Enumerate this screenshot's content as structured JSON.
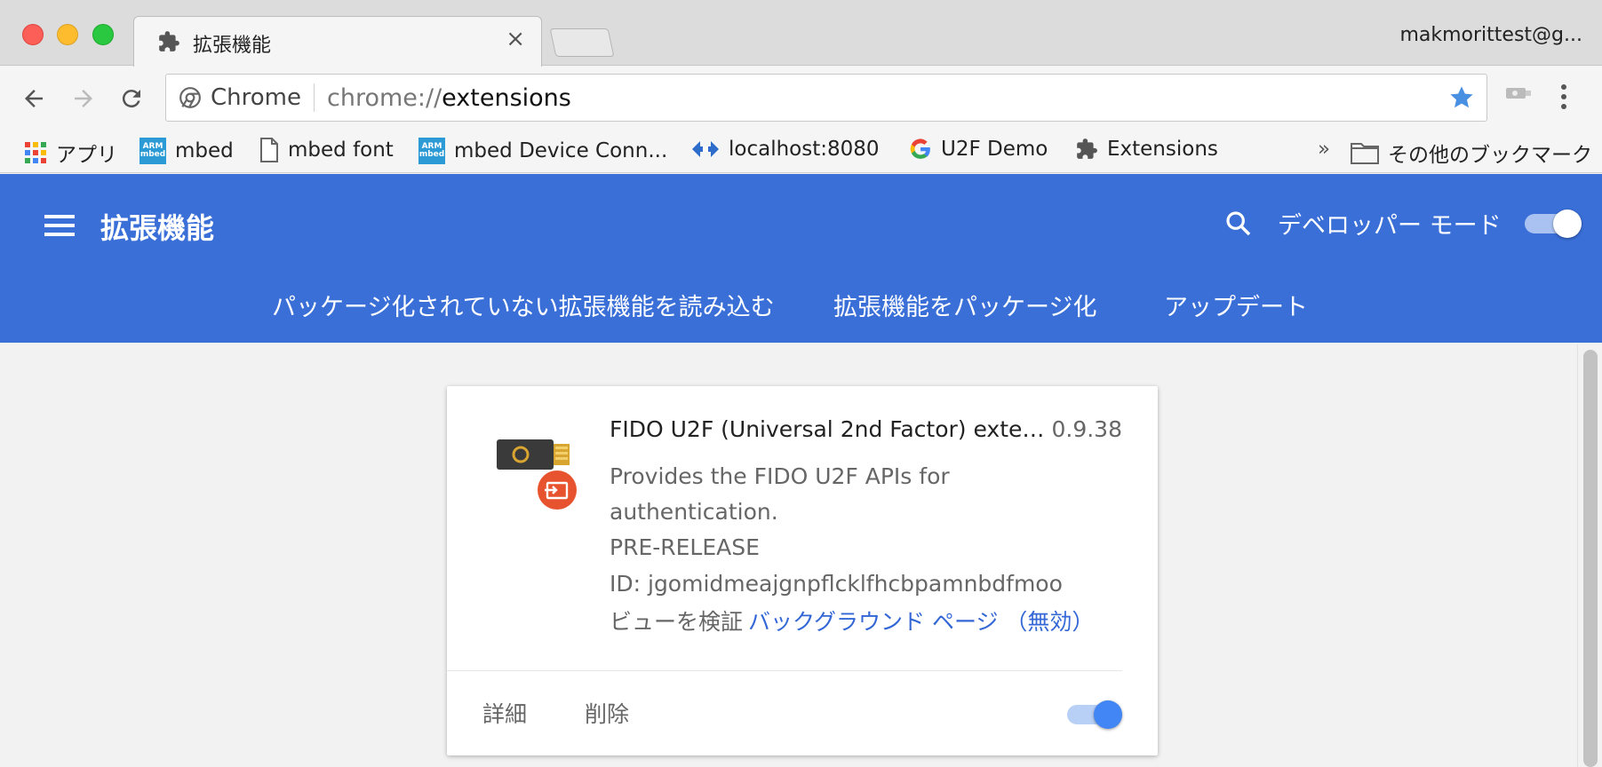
{
  "window": {
    "tab_title": "拡張機能",
    "tab_close": "×",
    "profile": "makmorittest@g..."
  },
  "toolbar": {
    "omnibox_chip": "Chrome",
    "url_prefix": "chrome://",
    "url_path": "extensions"
  },
  "bookmarks": [
    {
      "label": "アプリ",
      "icon": "apps-grid-icon"
    },
    {
      "label": "mbed",
      "icon": "arm-mbed-icon"
    },
    {
      "label": "mbed font",
      "icon": "page-icon"
    },
    {
      "label": "mbed Device Conn...",
      "icon": "arm-mbed-icon"
    },
    {
      "label": "localhost:8080",
      "icon": "localhost-icon"
    },
    {
      "label": "U2F Demo",
      "icon": "google-icon"
    },
    {
      "label": "Extensions",
      "icon": "puzzle-icon"
    }
  ],
  "bookmarks_overflow": "»",
  "bookmarks_other": "その他のブックマーク",
  "arm_logo_text": [
    "ARM",
    "mbed"
  ],
  "header": {
    "title": "拡張機能",
    "dev_mode_label": "デベロッパー モード",
    "dev_mode_on": true,
    "links": [
      "パッケージ化されていない拡張機能を読み込む",
      "拡張機能をパッケージ化",
      "アップデート"
    ]
  },
  "extension": {
    "name": "FIDO U2F (Universal 2nd Factor) extensi...",
    "version": "0.9.38",
    "description_line1": "Provides the FIDO U2F APIs for authentication.",
    "description_line2": "PRE-RELEASE",
    "id": "ID: jgomidmeajgnpflcklfhcbpamnbdfmoo",
    "inspect_label": "ビューを検証",
    "inspect_link": "バックグラウンド ページ （無効）",
    "details_button": "詳細",
    "remove_button": "削除",
    "enabled": true
  },
  "colors": {
    "header_blue": "#3a6fd8",
    "link_blue": "#3367d6",
    "toggle_blue": "#4285f4",
    "star_blue": "#4a90e2",
    "badge_orange": "#e8532f"
  }
}
